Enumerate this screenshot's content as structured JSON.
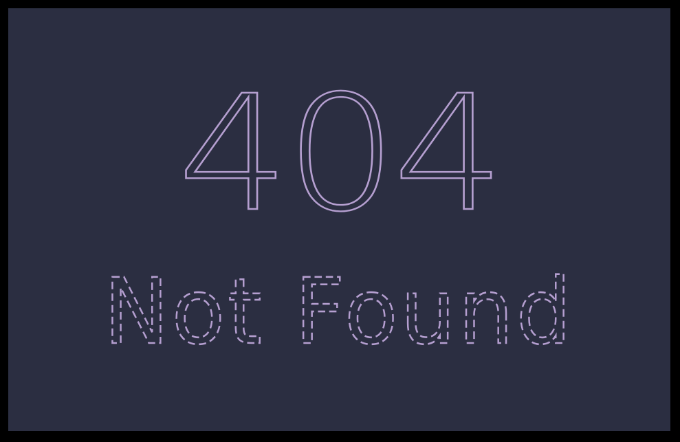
{
  "error": {
    "code": "404",
    "message": "Not Found"
  },
  "colors": {
    "outer": "#000000",
    "background": "#2b2e41",
    "accent": "#b59fd0"
  }
}
